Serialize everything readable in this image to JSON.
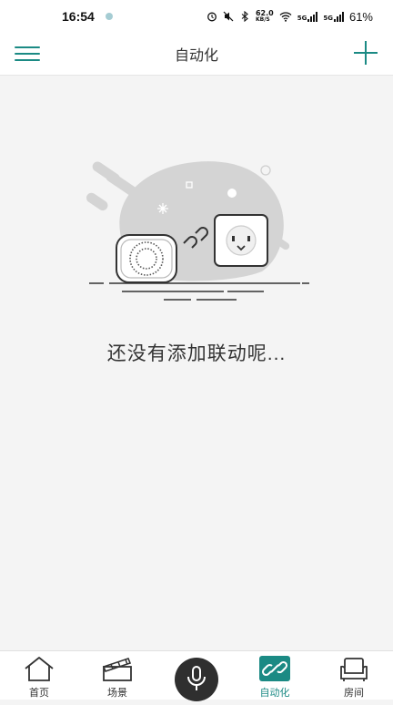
{
  "status_bar": {
    "time": "16:54",
    "net_speed_value": "62.0",
    "net_speed_unit": "KB/S",
    "sim1_label": "5G",
    "sim2_label": "5G",
    "battery": "61%"
  },
  "header": {
    "title": "自动化",
    "menu_icon": "hamburger-icon",
    "add_icon": "plus-icon"
  },
  "empty_state": {
    "message": "还没有添加联动呢..."
  },
  "tab_bar": {
    "items": [
      {
        "label": "首页",
        "icon": "home-icon",
        "active": false
      },
      {
        "label": "场景",
        "icon": "clapperboard-icon",
        "active": false
      },
      {
        "label": "自动化",
        "icon": "link-icon",
        "active": true
      },
      {
        "label": "房间",
        "icon": "sofa-icon",
        "active": false
      }
    ],
    "voice_icon": "microphone-icon"
  },
  "colors": {
    "accent": "#1b8a84",
    "background": "#f4f4f4",
    "illustration_gray": "#d4d4d4"
  }
}
